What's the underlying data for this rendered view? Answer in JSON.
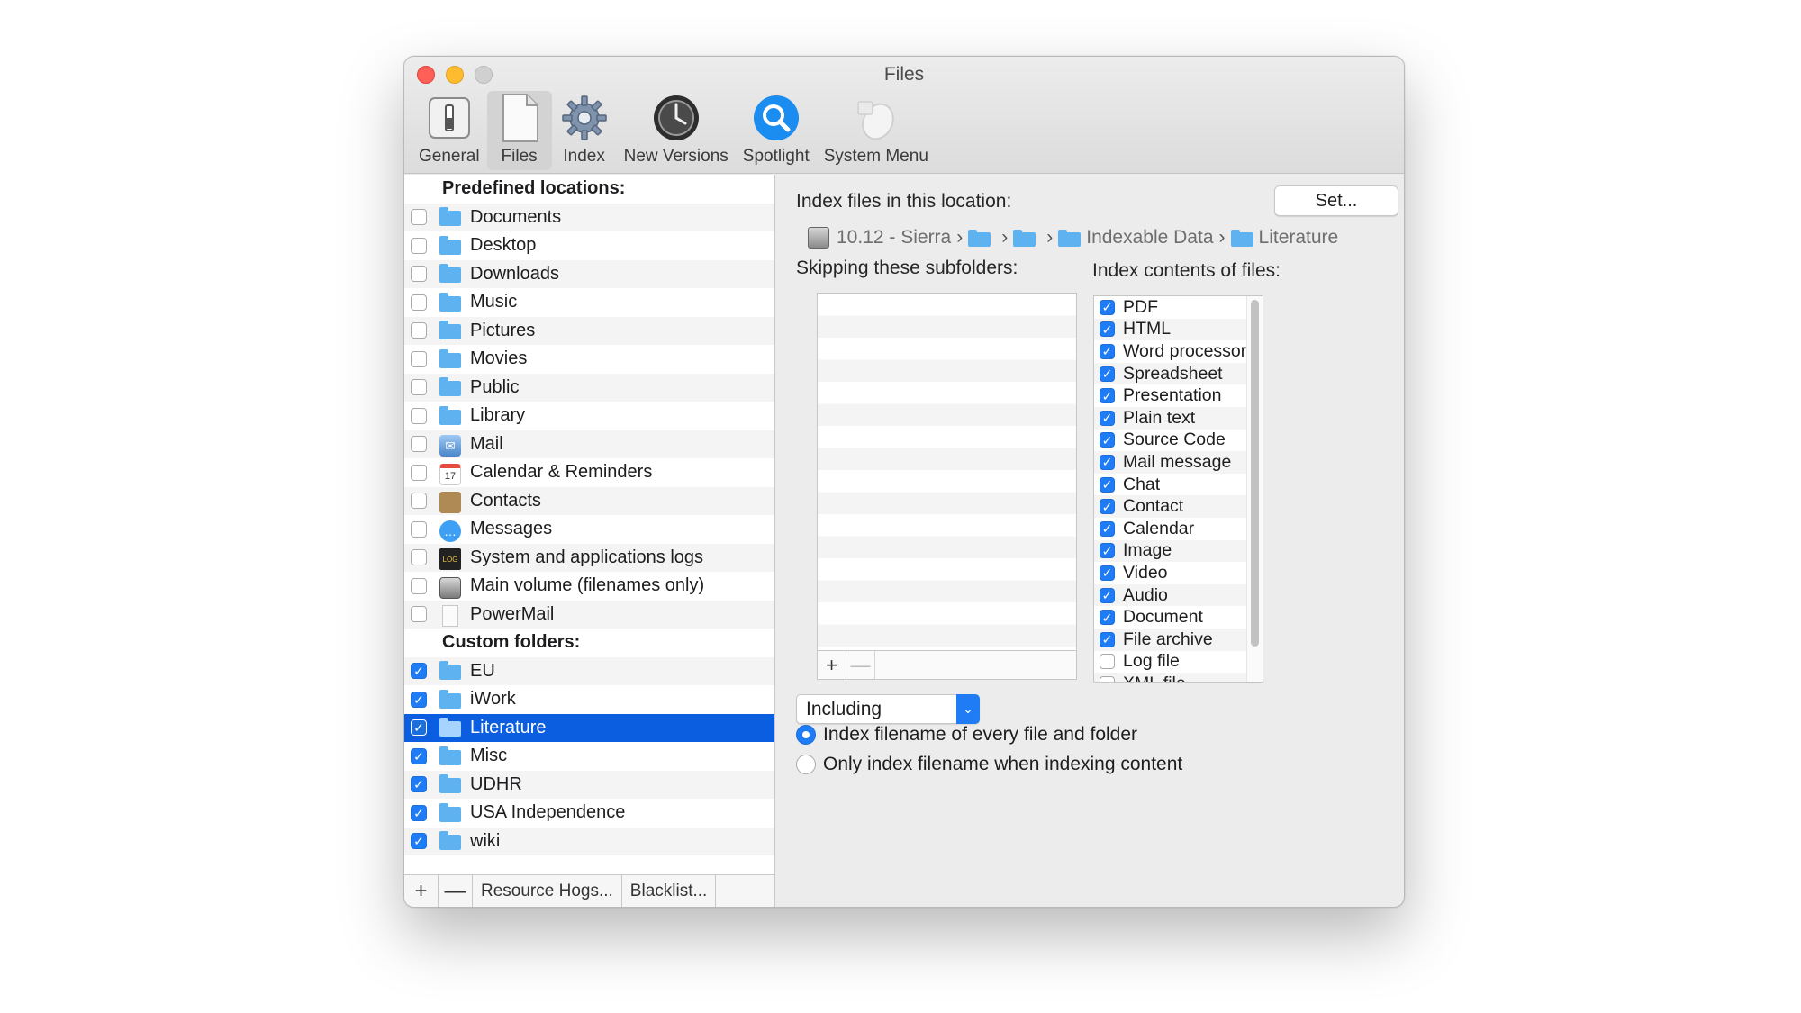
{
  "window": {
    "title": "Files"
  },
  "toolbar": {
    "items": [
      {
        "label": "General",
        "icon": "switch-icon"
      },
      {
        "label": "Files",
        "icon": "document-icon",
        "active": true
      },
      {
        "label": "Index",
        "icon": "gear-icon"
      },
      {
        "label": "New Versions",
        "icon": "time-machine-icon"
      },
      {
        "label": "Spotlight",
        "icon": "spotlight-icon"
      },
      {
        "label": "System Menu",
        "icon": "mouse-icon"
      }
    ]
  },
  "locations": {
    "predefined_header": "Predefined locations:",
    "predefined": [
      {
        "label": "Documents",
        "checked": false,
        "icon": "documents-folder-icon"
      },
      {
        "label": "Desktop",
        "checked": false,
        "icon": "desktop-folder-icon"
      },
      {
        "label": "Downloads",
        "checked": false,
        "icon": "downloads-folder-icon"
      },
      {
        "label": "Music",
        "checked": false,
        "icon": "music-folder-icon"
      },
      {
        "label": "Pictures",
        "checked": false,
        "icon": "pictures-folder-icon"
      },
      {
        "label": "Movies",
        "checked": false,
        "icon": "movies-folder-icon"
      },
      {
        "label": "Public",
        "checked": false,
        "icon": "public-folder-icon"
      },
      {
        "label": "Library",
        "checked": false,
        "icon": "library-folder-icon"
      },
      {
        "label": "Mail",
        "checked": false,
        "icon": "mail-app-icon"
      },
      {
        "label": "Calendar & Reminders",
        "checked": false,
        "icon": "calendar-app-icon"
      },
      {
        "label": "Contacts",
        "checked": false,
        "icon": "contacts-app-icon"
      },
      {
        "label": "Messages",
        "checked": false,
        "icon": "messages-app-icon"
      },
      {
        "label": "System and applications logs",
        "checked": false,
        "icon": "console-app-icon"
      },
      {
        "label": "Main volume (filenames only)",
        "checked": false,
        "icon": "hard-disk-icon"
      },
      {
        "label": "PowerMail",
        "checked": false,
        "icon": "blank-document-icon"
      }
    ],
    "custom_header": "Custom folders:",
    "custom": [
      {
        "label": "EU",
        "checked": true
      },
      {
        "label": "iWork",
        "checked": true
      },
      {
        "label": "Literature",
        "checked": true,
        "selected": true
      },
      {
        "label": "Misc",
        "checked": true
      },
      {
        "label": "UDHR",
        "checked": true
      },
      {
        "label": "USA Independence",
        "checked": true
      },
      {
        "label": "wiki",
        "checked": true
      }
    ]
  },
  "left_footer": {
    "add": "+",
    "remove": "—",
    "resource_hogs": "Resource Hogs...",
    "blacklist": "Blacklist..."
  },
  "index_location": {
    "label": "Index files in this location:",
    "set_button": "Set...",
    "path": [
      {
        "label": "10.12 - Sierra",
        "icon": "hard-disk-icon"
      },
      {
        "label": "",
        "icon": "folder-icon"
      },
      {
        "label": "",
        "icon": "folder-icon"
      },
      {
        "label": "Indexable Data",
        "icon": "folder-icon"
      },
      {
        "label": "Literature",
        "icon": "folder-icon"
      }
    ],
    "separator": "›"
  },
  "skipping": {
    "label": "Skipping these subfolders:",
    "add": "+",
    "remove": "—"
  },
  "index_contents": {
    "label": "Index contents of files:",
    "types": [
      {
        "label": "PDF",
        "checked": true
      },
      {
        "label": "HTML",
        "checked": true
      },
      {
        "label": "Word processor",
        "checked": true
      },
      {
        "label": "Spreadsheet",
        "checked": true
      },
      {
        "label": "Presentation",
        "checked": true
      },
      {
        "label": "Plain text",
        "checked": true
      },
      {
        "label": "Source Code",
        "checked": true
      },
      {
        "label": "Mail message",
        "checked": true
      },
      {
        "label": "Chat",
        "checked": true
      },
      {
        "label": "Contact",
        "checked": true
      },
      {
        "label": "Calendar",
        "checked": true
      },
      {
        "label": "Image",
        "checked": true
      },
      {
        "label": "Video",
        "checked": true
      },
      {
        "label": "Audio",
        "checked": true
      },
      {
        "label": "Document",
        "checked": true
      },
      {
        "label": "File archive",
        "checked": true
      },
      {
        "label": "Log file",
        "checked": false
      },
      {
        "label": "XML file",
        "checked": false
      }
    ]
  },
  "filter": {
    "selected": "Including"
  },
  "filename_options": [
    {
      "label": "Index filename of every file and folder",
      "selected": true
    },
    {
      "label": "Only index filename when indexing content",
      "selected": false
    }
  ],
  "colors": {
    "accent": "#1f7cf4",
    "selection": "#0c5ee0",
    "folder": "#5fb2f0"
  }
}
